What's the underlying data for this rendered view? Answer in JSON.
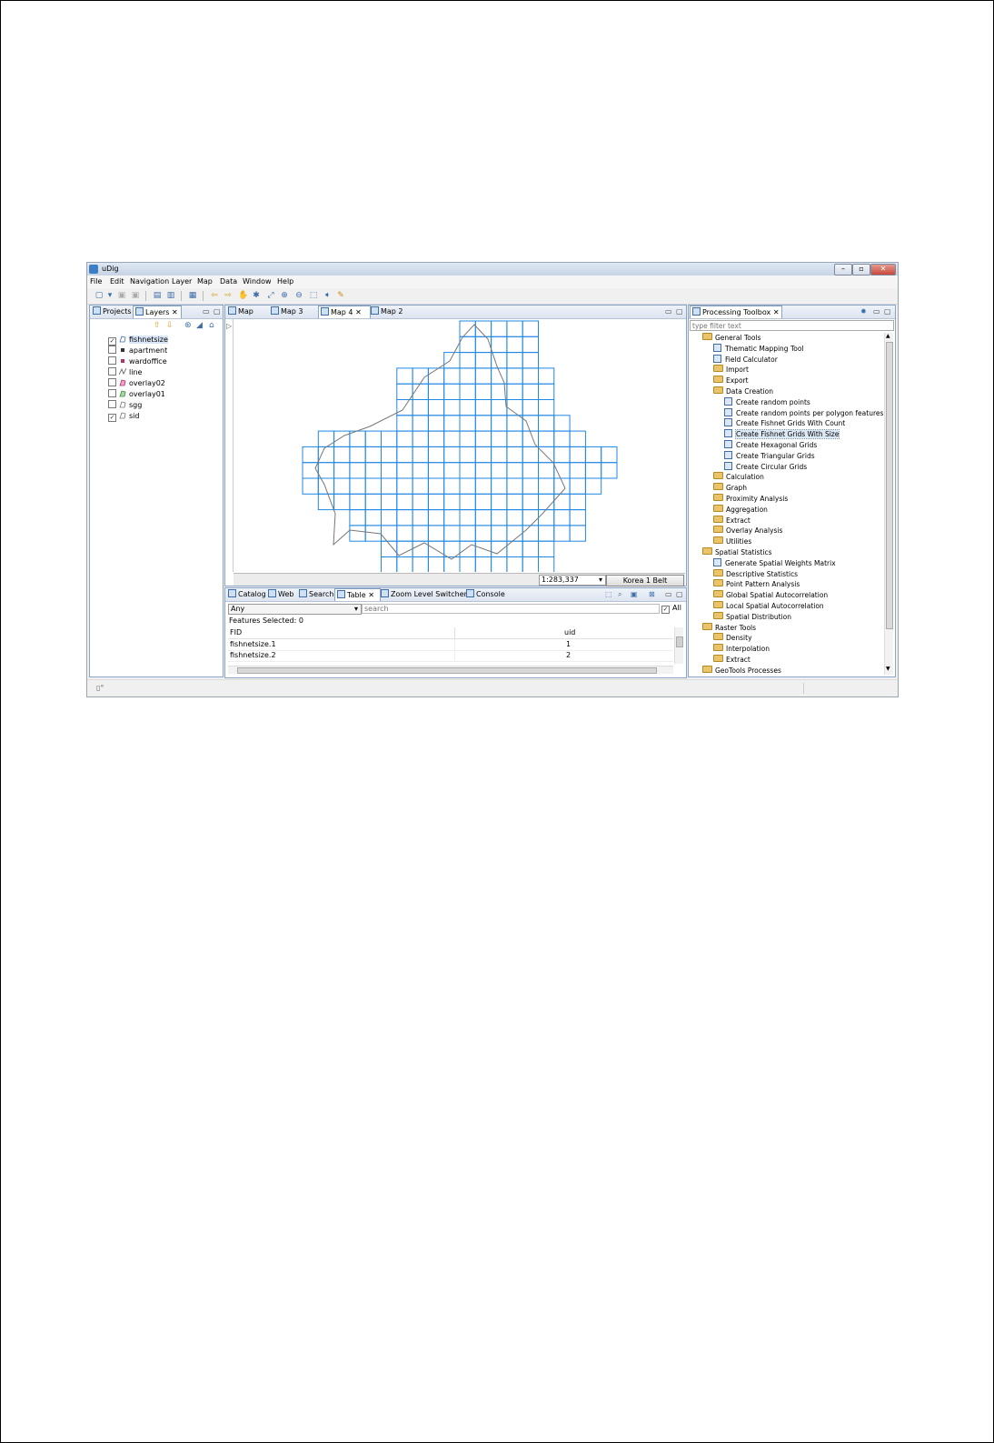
{
  "window": {
    "title": "uDig"
  },
  "menu": [
    "File",
    "Edit",
    "Navigation",
    "Layer",
    "Map",
    "Data",
    "Window",
    "Help"
  ],
  "left_panel": {
    "tabs": [
      "Projects",
      "Layers"
    ],
    "layers": [
      {
        "name": "fishnetsize",
        "checked": true
      },
      {
        "name": "apartment",
        "checked": false
      },
      {
        "name": "wardoffice",
        "checked": false
      },
      {
        "name": "line",
        "checked": false
      },
      {
        "name": "overlay02",
        "checked": false
      },
      {
        "name": "overlay01",
        "checked": false
      },
      {
        "name": "sgg",
        "checked": false
      },
      {
        "name": "sid",
        "checked": true
      }
    ]
  },
  "map_tabs": [
    "Map",
    "Map 3",
    "Map 4",
    "Map 2"
  ],
  "map_status": {
    "scale": "1:283,337",
    "crs": "Korea 1 Belt"
  },
  "bottom_panel": {
    "tabs": [
      "Catalog",
      "Web",
      "Search",
      "Table",
      "Zoom Level Switcher",
      "Console"
    ],
    "filter_value": "Any",
    "search_placeholder": "search",
    "all_label": "All",
    "features_selected": "Features Selected: 0",
    "columns": [
      "FID",
      "uid"
    ],
    "rows": [
      {
        "fid": "fishnetsize.1",
        "uid": "1"
      },
      {
        "fid": "fishnetsize.2",
        "uid": "2"
      }
    ]
  },
  "toolbox": {
    "title": "Processing Toolbox",
    "filter_placeholder": "type filter text",
    "items": [
      {
        "label": "General Tools",
        "type": "folder",
        "level": 0
      },
      {
        "label": "Thematic Mapping Tool",
        "type": "tool",
        "level": 1
      },
      {
        "label": "Field Calculator",
        "type": "tool",
        "level": 1
      },
      {
        "label": "Import",
        "type": "folder",
        "level": 1
      },
      {
        "label": "Export",
        "type": "folder",
        "level": 1
      },
      {
        "label": "Data Creation",
        "type": "folder",
        "level": 1
      },
      {
        "label": "Create random points",
        "type": "tool",
        "level": 2
      },
      {
        "label": "Create random points per polygon features",
        "type": "tool",
        "level": 2
      },
      {
        "label": "Create Fishnet Grids With Count",
        "type": "tool",
        "level": 2
      },
      {
        "label": "Create Fishnet Grids With Size",
        "type": "tool",
        "level": 2,
        "selected": true
      },
      {
        "label": "Create Hexagonal Grids",
        "type": "tool",
        "level": 2
      },
      {
        "label": "Create Triangular Grids",
        "type": "tool",
        "level": 2
      },
      {
        "label": "Create Circular Grids",
        "type": "tool",
        "level": 2
      },
      {
        "label": "Calculation",
        "type": "folder",
        "level": 1
      },
      {
        "label": "Graph",
        "type": "folder",
        "level": 1
      },
      {
        "label": "Proximity Analysis",
        "type": "folder",
        "level": 1
      },
      {
        "label": "Aggregation",
        "type": "folder",
        "level": 1
      },
      {
        "label": "Extract",
        "type": "folder",
        "level": 1
      },
      {
        "label": "Overlay Analysis",
        "type": "folder",
        "level": 1
      },
      {
        "label": "Utilities",
        "type": "folder",
        "level": 1
      },
      {
        "label": "Spatial Statistics",
        "type": "folder",
        "level": 0
      },
      {
        "label": "Generate Spatial Weights Matrix",
        "type": "tool",
        "level": 1
      },
      {
        "label": "Descriptive Statistics",
        "type": "folder",
        "level": 1
      },
      {
        "label": "Point Pattern Analysis",
        "type": "folder",
        "level": 1
      },
      {
        "label": "Global Spatial Autocorrelation",
        "type": "folder",
        "level": 1
      },
      {
        "label": "Local Spatial Autocorrelation",
        "type": "folder",
        "level": 1
      },
      {
        "label": "Spatial Distribution",
        "type": "folder",
        "level": 1
      },
      {
        "label": "Raster Tools",
        "type": "folder",
        "level": 0
      },
      {
        "label": "Density",
        "type": "folder",
        "level": 1
      },
      {
        "label": "Interpolation",
        "type": "folder",
        "level": 1
      },
      {
        "label": "Extract",
        "type": "folder",
        "level": 1
      },
      {
        "label": "GeoTools Processes",
        "type": "folder",
        "level": 0
      }
    ]
  },
  "colors": {
    "grid": "#1e88e5",
    "boundary": "#777777",
    "accent": "#3e6ea8"
  }
}
